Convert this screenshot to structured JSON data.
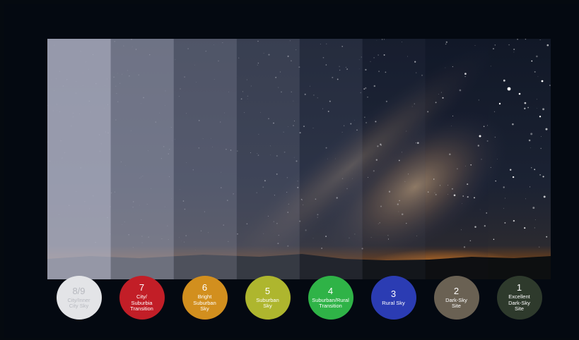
{
  "scale": [
    {
      "number": "8/9",
      "label": "City/Inner City Sky",
      "lines": [
        "City/Inner",
        "City Sky"
      ],
      "color": "#e3e4e7",
      "text_color": "#b7b9bf"
    },
    {
      "number": "7",
      "label": "City/ Suburbia Transition",
      "lines": [
        "City/",
        "Suburbia",
        "Transition"
      ],
      "color": "#c21e27",
      "text_color": "#ffffff"
    },
    {
      "number": "6",
      "label": "Bright Suburban Sky",
      "lines": [
        "Bright",
        "Suburban",
        "Sky"
      ],
      "color": "#d28f1e",
      "text_color": "#ffffff"
    },
    {
      "number": "5",
      "label": "Suburban Sky",
      "lines": [
        "Suburban",
        "Sky"
      ],
      "color": "#aeb62e",
      "text_color": "#ffffff"
    },
    {
      "number": "4",
      "label": "Suburban/Rural Transition",
      "lines": [
        "Suburban/Rural",
        "Transition"
      ],
      "color": "#2fb347",
      "text_color": "#ffffff"
    },
    {
      "number": "3",
      "label": "Rural Sky",
      "lines": [
        "Rural Sky"
      ],
      "color": "#2b3cb3",
      "text_color": "#ffffff"
    },
    {
      "number": "2",
      "label": "Dark-Sky Site",
      "lines": [
        "Dark-Sky",
        "Site"
      ],
      "color": "#6a6153",
      "text_color": "#ffffff"
    },
    {
      "number": "1",
      "label": "Excellent Dark-Sky Site",
      "lines": [
        "Excellent",
        "Dark-Sky",
        "Site"
      ],
      "color": "#2e3a2c",
      "text_color": "#ffffff"
    }
  ],
  "strip_overlays": [
    "#b3b6c8",
    "#9fa2b6",
    "#8a8ea3",
    "#767a92",
    "#5b607a",
    "#3b3f57",
    "#1c2035",
    "#000000"
  ],
  "strip_opacity": [
    0.82,
    0.66,
    0.52,
    0.4,
    0.28,
    0.16,
    0.07,
    0
  ]
}
